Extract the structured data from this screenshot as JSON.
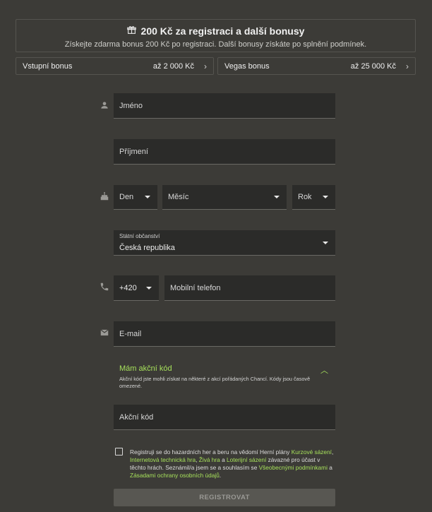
{
  "promo": {
    "title": "200 Kč za registraci a další bonusy",
    "subtitle": "Získejte zdarma bonus 200 Kč po registraci. Další bonusy získáte po splnění podmínek.",
    "icon": "gift-icon"
  },
  "bonuses": [
    {
      "label": "Vstupní bonus",
      "amount": "až 2 000 Kč"
    },
    {
      "label": "Vegas bonus",
      "amount": "až 25 000 Kč"
    }
  ],
  "form": {
    "first_name_placeholder": "Jméno",
    "last_name_placeholder": "Příjmení",
    "day_placeholder": "Den",
    "month_placeholder": "Měsíc",
    "year_placeholder": "Rok",
    "citizenship_label": "Státní občanství",
    "citizenship_value": "Česká republika",
    "phone_prefix": "+420",
    "phone_placeholder": "Mobilní telefon",
    "email_placeholder": "E-mail",
    "promo_code_title": "Mám akční kód",
    "promo_code_desc": "Akční kód jste mohli získat na některé z akcí pořádaných Chancí. Kódy jsou časově omezené.",
    "promo_code_placeholder": "Akční kód",
    "submit_label": "REGISTROVAT"
  },
  "terms": {
    "t1": "Registruji se do hazardních her a beru na vědomí Herní plány ",
    "l1": "Kurzové sázení",
    "t2": ", ",
    "l2": "Internetová technická hra",
    "t3": ", ",
    "l3": "Živá hra",
    "t4": " a ",
    "l4": "Loterijní sázení",
    "t5": " závazné pro účast v těchto hrách. Seznámil/a jsem se a souhlasím se ",
    "l5": "Všeobecnými podmínkami",
    "t6": " a ",
    "l6": "Zásadami ochrany osobních údajů",
    "t7": "."
  },
  "colors": {
    "background": "#3c3b37",
    "field": "#2b2b29",
    "accent_link": "#a6e05b"
  }
}
